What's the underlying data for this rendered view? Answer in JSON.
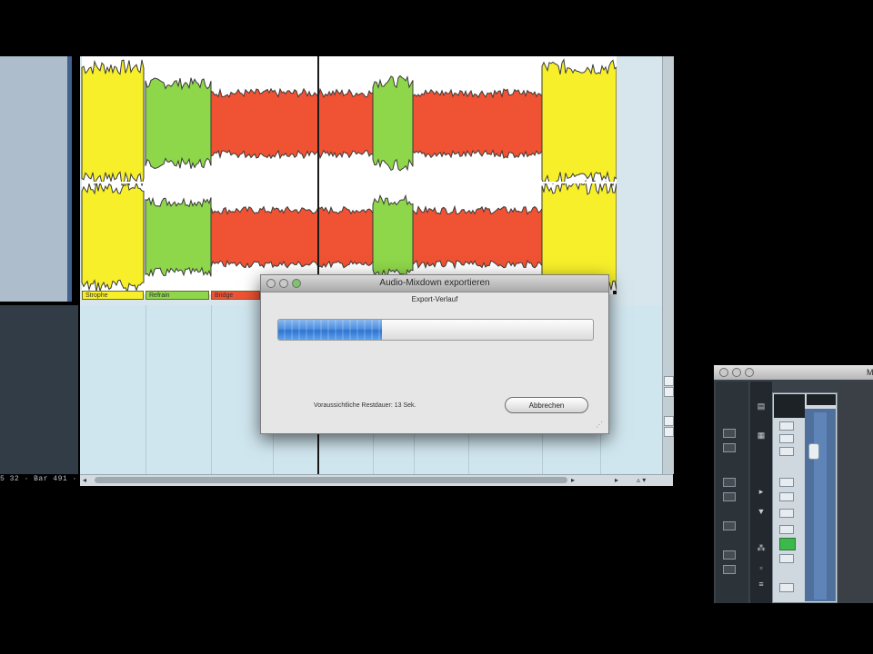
{
  "left_status": "5 32 · Bar 491 ·",
  "arrangement": {
    "clips": [
      {
        "label": "Strophe",
        "color": "#f6ef2a"
      },
      {
        "label": "Refrain",
        "color": "#8ed64a"
      },
      {
        "label": "Bridge",
        "color": "#f05234"
      }
    ]
  },
  "dialog": {
    "title": "Audio-Mixdown exportieren",
    "subtitle": "Export-Verlauf",
    "progress_fraction": 0.33,
    "remaining": "Voraussichtliche Restdauer: 13 Sek.",
    "cancel_label": "Abbrechen"
  },
  "mixer": {
    "title_fragment": "M"
  },
  "scroll": {
    "left_arrow": "◂",
    "right_arrow": "▸",
    "zoom_glyph": "▵ ▾",
    "resize_glyph": "⋰"
  },
  "colors": {
    "verse": "#f6ef2a",
    "chorus": "#8ed64a",
    "bridge": "#f05234",
    "progress": "#3a7fd8"
  }
}
